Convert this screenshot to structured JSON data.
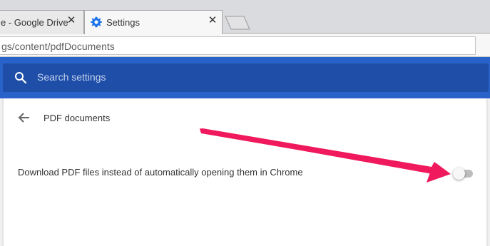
{
  "tabs": [
    {
      "label": "e - Google Drive"
    },
    {
      "label": "Settings"
    }
  ],
  "omnibox": {
    "url": "gs/content/pdfDocuments"
  },
  "search": {
    "placeholder": "Search settings"
  },
  "page": {
    "title": "PDF documents",
    "setting_label": "Download PDF files instead of automatically opening them in Chrome",
    "toggle_on": false
  },
  "colors": {
    "header": "#2962c8",
    "search_bar": "#1f4ea8",
    "annotation_arrow": "#f0195d"
  },
  "icons": [
    "close-icon",
    "gear-icon",
    "search-icon",
    "back-arrow-icon",
    "new-tab-icon",
    "annotation-arrow"
  ]
}
